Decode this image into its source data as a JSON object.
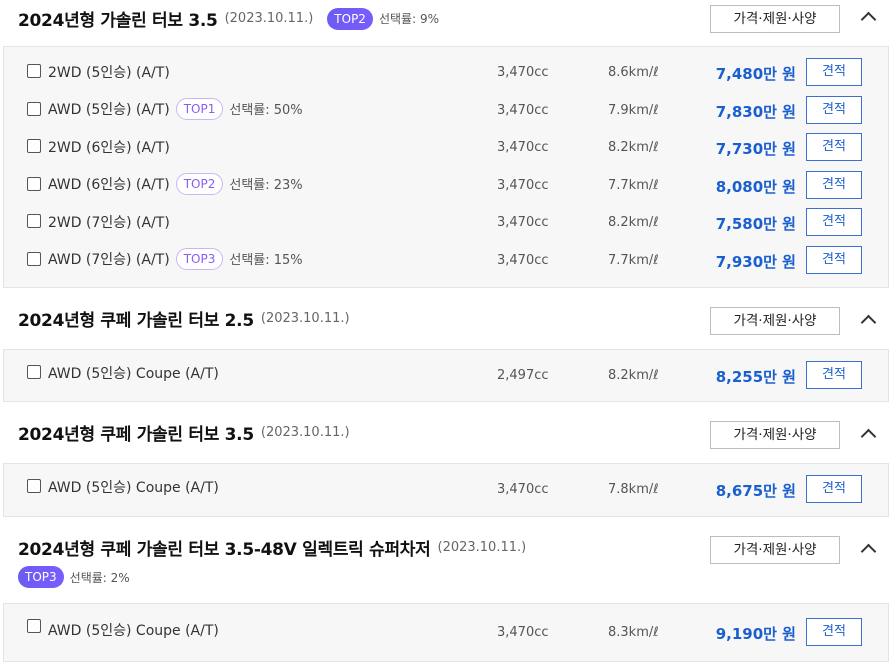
{
  "spec_label": "가격·제원·사양",
  "estimate_label": "견적",
  "pick_prefix": "선택률: ",
  "price_unit": "만 원",
  "colors": {
    "accent_blue": "#1a5fd0",
    "top_badge": "#7b5cff"
  },
  "sections": [
    {
      "title": "2024년형 가솔린 터보 3.5",
      "date": "(2023.10.11.)",
      "badge": "TOP2",
      "pick_rate": "9%",
      "trims": [
        {
          "name": "2WD (5인승) (A/T)",
          "badge": "",
          "pick_rate": "",
          "displacement": "3,470cc",
          "efficiency": "8.6km/ℓ",
          "price": "7,480만 원"
        },
        {
          "name": "AWD (5인승) (A/T)",
          "badge": "TOP1",
          "pick_rate": "선택률: 50%",
          "displacement": "3,470cc",
          "efficiency": "7.9km/ℓ",
          "price": "7,830만 원"
        },
        {
          "name": "2WD (6인승) (A/T)",
          "badge": "",
          "pick_rate": "",
          "displacement": "3,470cc",
          "efficiency": "8.2km/ℓ",
          "price": "7,730만 원"
        },
        {
          "name": "AWD (6인승) (A/T)",
          "badge": "TOP2",
          "pick_rate": "선택률: 23%",
          "displacement": "3,470cc",
          "efficiency": "7.7km/ℓ",
          "price": "8,080만 원"
        },
        {
          "name": "2WD (7인승) (A/T)",
          "badge": "",
          "pick_rate": "",
          "displacement": "3,470cc",
          "efficiency": "8.2km/ℓ",
          "price": "7,580만 원"
        },
        {
          "name": "AWD (7인승) (A/T)",
          "badge": "TOP3",
          "pick_rate": "선택률: 15%",
          "displacement": "3,470cc",
          "efficiency": "7.7km/ℓ",
          "price": "7,930만 원"
        }
      ]
    },
    {
      "title": "2024년형 쿠페 가솔린 터보 2.5",
      "date": "(2023.10.11.)",
      "trims": [
        {
          "name": "AWD (5인승) Coupe (A/T)",
          "displacement": "2,497cc",
          "efficiency": "8.2km/ℓ",
          "price": "8,255만 원"
        }
      ]
    },
    {
      "title": "2024년형 쿠페 가솔린 터보 3.5",
      "date": "(2023.10.11.)",
      "trims": [
        {
          "name": "AWD (5인승) Coupe (A/T)",
          "displacement": "3,470cc",
          "efficiency": "7.8km/ℓ",
          "price": "8,675만 원"
        }
      ]
    },
    {
      "title": "2024년형 쿠페 가솔린 터보 3.5-48V 일렉트릭 슈퍼차저",
      "date": "(2023.10.11.)",
      "badge": "TOP3",
      "pick_rate": "선택률: 2%",
      "trims": [
        {
          "name": "AWD (5인승) Coupe (A/T)",
          "displacement": "3,470cc",
          "efficiency": "8.3km/ℓ",
          "price": "9,190만 원"
        }
      ]
    }
  ]
}
